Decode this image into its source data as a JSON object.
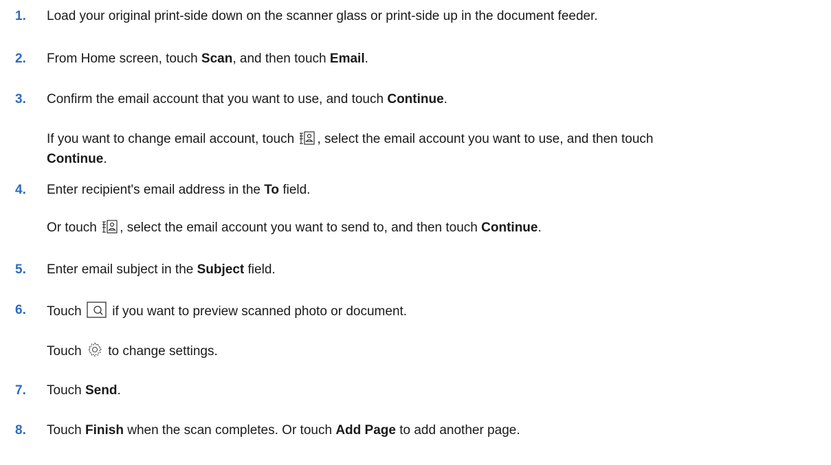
{
  "steps": [
    {
      "number": "1.",
      "text": "Load your original print-side down on the scanner glass or print-side up in the document feeder."
    },
    {
      "number": "2.",
      "pre": "From Home screen, touch ",
      "b1": "Scan",
      "mid": ", and then touch ",
      "b2": "Email",
      "post": "."
    },
    {
      "number": "3.",
      "pre": "Confirm the email account that you want to use, and touch ",
      "b1": "Continue",
      "post": ".",
      "sub": {
        "pre": "If you want to change email account, touch ",
        "icon": "contacts-icon",
        "mid": ", select the email account you want to use, and then touch",
        "b1": "Continue",
        "post": "."
      }
    },
    {
      "number": "4.",
      "pre": "Enter recipient's email address in the ",
      "b1": "To",
      "post": " field.",
      "sub": {
        "pre": "Or touch ",
        "icon": "contacts-icon",
        "mid": ", select the email account you want to send to, and then touch ",
        "b1": "Continue",
        "post": "."
      }
    },
    {
      "number": "5.",
      "pre": "Enter email subject in the ",
      "b1": "Subject",
      "post": " field."
    },
    {
      "number": "6.",
      "pre": "Touch ",
      "icon": "preview-icon",
      "post": " if you want to preview scanned photo or document.",
      "sub": {
        "pre": "Touch ",
        "icon": "settings-gear-icon",
        "post": " to change settings."
      }
    },
    {
      "number": "7.",
      "pre": "Touch ",
      "b1": "Send",
      "post": "."
    },
    {
      "number": "8.",
      "pre": "Touch ",
      "b1": "Finish",
      "mid": " when the scan completes. Or touch ",
      "b2": "Add Page",
      "post": " to add another page."
    }
  ],
  "colors": {
    "number": "#2f6bbf",
    "text": "#1a1a1a"
  }
}
